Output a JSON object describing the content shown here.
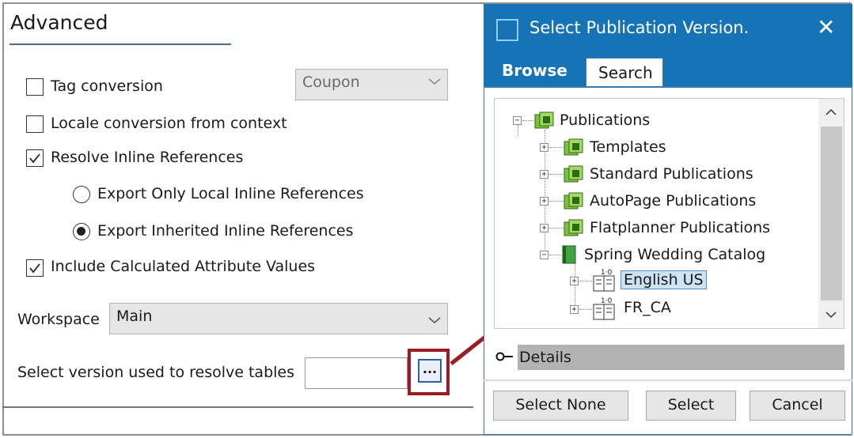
{
  "panel": {
    "title": "Advanced",
    "tag_conversion": {
      "label": "Tag conversion",
      "checked": false,
      "combo_value": "Coupon"
    },
    "locale_conversion": {
      "label": "Locale conversion from context",
      "checked": false
    },
    "resolve_inline": {
      "label": "Resolve Inline References",
      "checked": true
    },
    "export_local": {
      "label": "Export Only Local Inline References",
      "selected": false
    },
    "export_inherited": {
      "label": "Export Inherited Inline References",
      "selected": true
    },
    "include_calculated": {
      "label": "Include Calculated Attribute Values",
      "checked": true
    },
    "workspace": {
      "label": "Workspace",
      "value": "Main"
    },
    "select_version": {
      "label": "Select version used to resolve tables",
      "value": "",
      "browse_label": "..."
    }
  },
  "dialog": {
    "title": "Select Publication Version.",
    "close": "✕",
    "tabs": [
      {
        "label": "Browse",
        "active": true
      },
      {
        "label": "Search",
        "active": false
      }
    ],
    "tree": {
      "root": "Publications",
      "children": [
        "Templates",
        "Standard Publications",
        "AutoPage Publications",
        "Flatplanner Publications",
        "Spring Wedding Catalog"
      ],
      "versions": [
        "English US",
        "FR_CA"
      ],
      "selected": "English US"
    },
    "details_label": "Details",
    "buttons": {
      "select_none": "Select None",
      "select": "Select",
      "cancel": "Cancel"
    }
  },
  "colors": {
    "title_bar": "#1674b6",
    "callout": "#9b1c24",
    "selection": "#cce3f7"
  }
}
